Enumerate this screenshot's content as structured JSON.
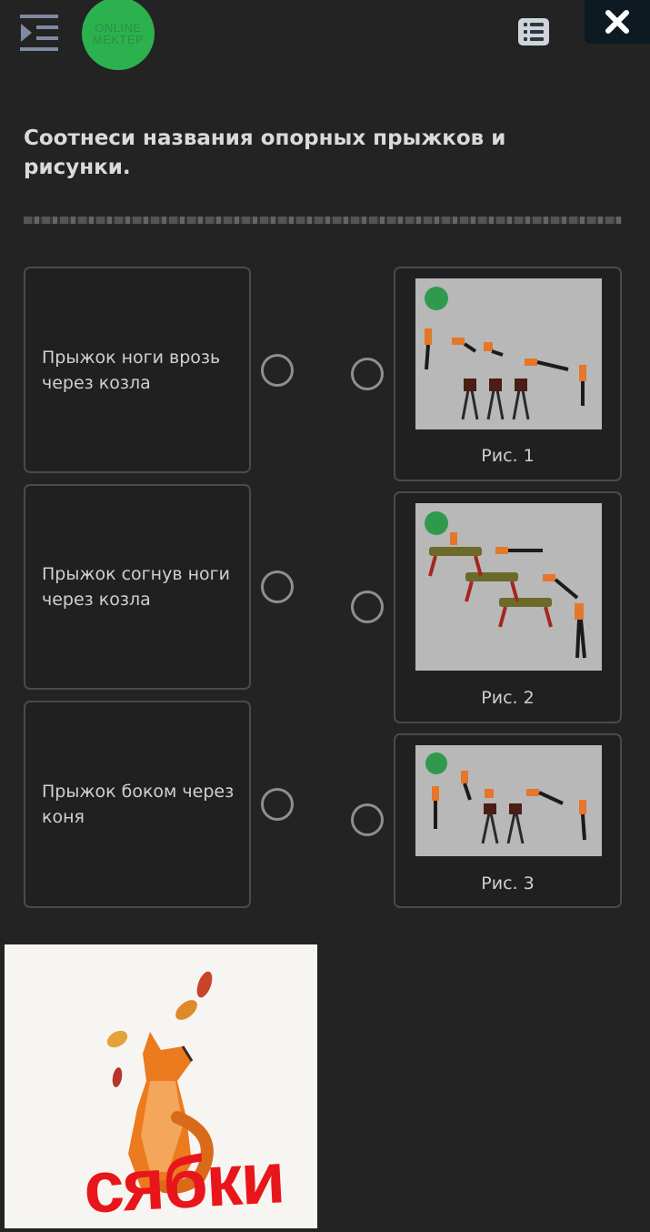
{
  "header": {
    "logo_line1": "ONLINE",
    "logo_line2": "MEKTEP",
    "menu_icon": "menu-indent-icon",
    "list_icon": "list-icon",
    "close_icon": "close-icon"
  },
  "task": {
    "title": "Соотнеси названия опорных прыжков и рисунки."
  },
  "left_items": [
    {
      "label": "Прыжок ноги врозь через козла"
    },
    {
      "label": "Прыжок согнув ноги через козла"
    },
    {
      "label": "Прыжок боком через коня"
    }
  ],
  "right_items": [
    {
      "caption": "Рис. 1"
    },
    {
      "caption": "Рис. 2"
    },
    {
      "caption": "Рис. 3"
    }
  ],
  "sticker": {
    "text": "сябки"
  },
  "colors": {
    "background": "#232323",
    "logo_green": "#2bb24f",
    "sticker_red": "#e8161b"
  }
}
